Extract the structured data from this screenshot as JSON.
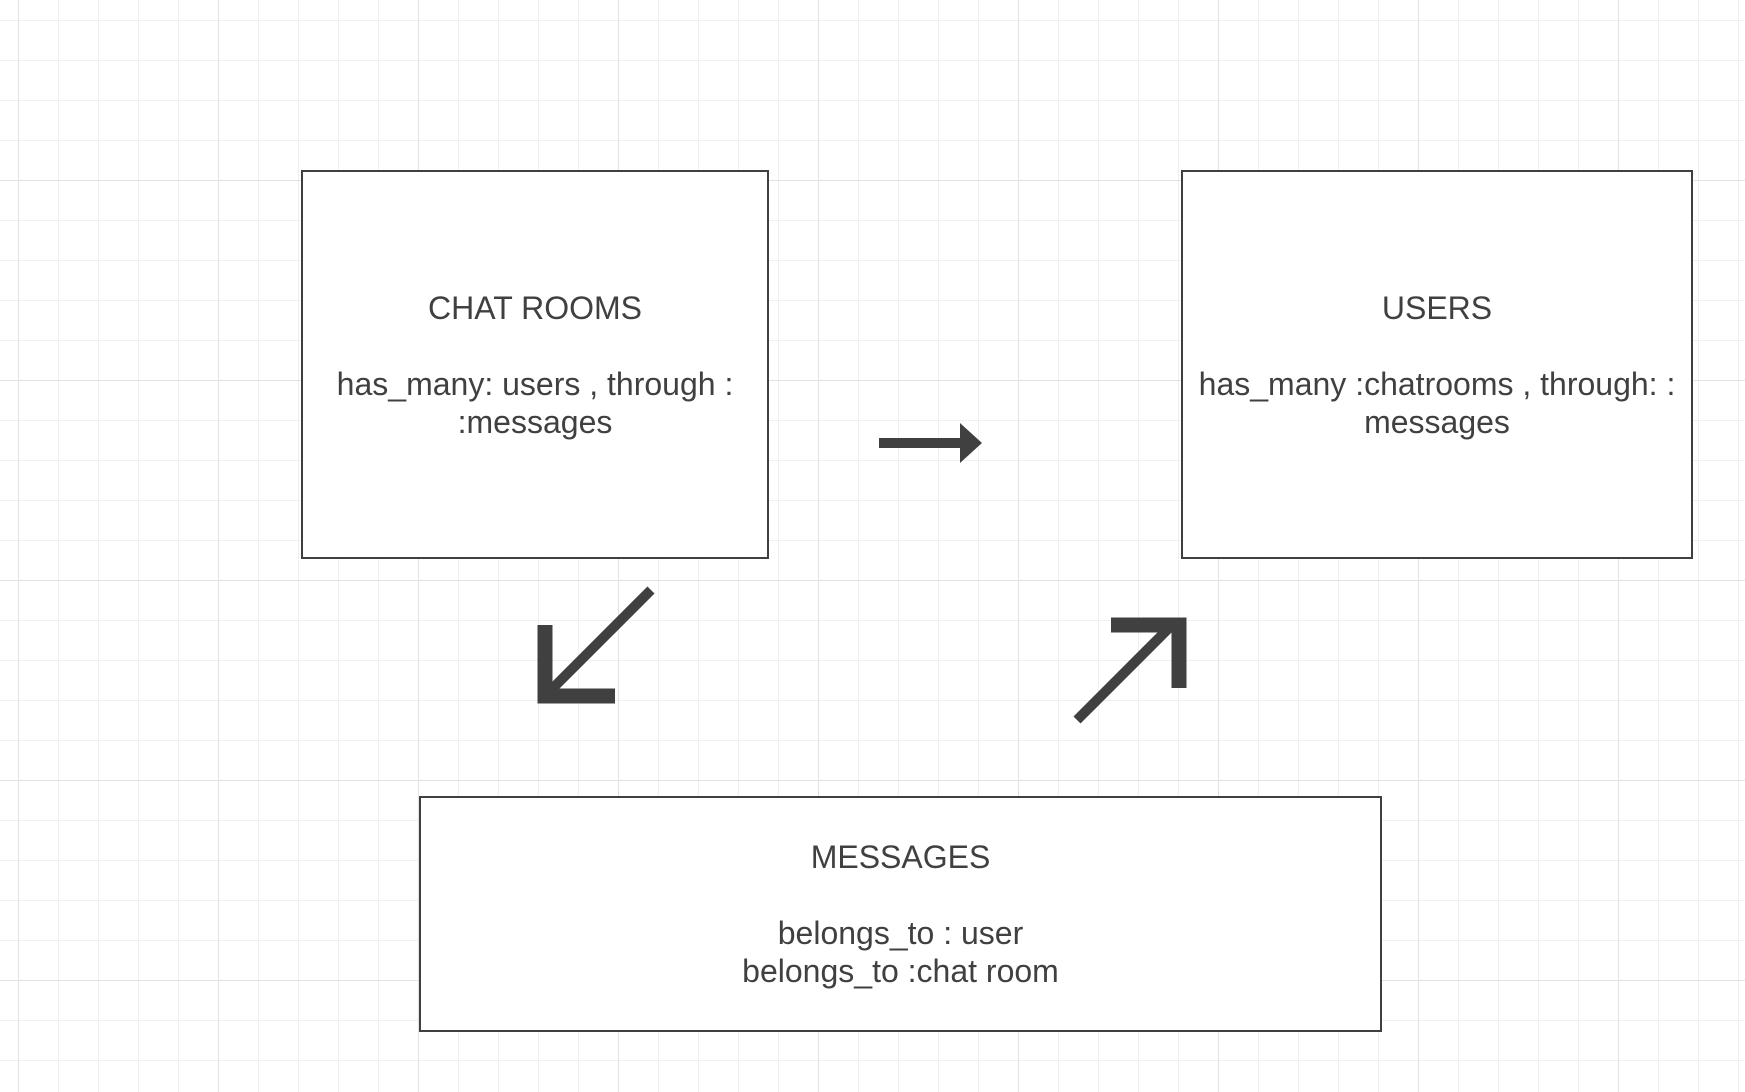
{
  "entities": {
    "chat_rooms": {
      "title": "CHAT ROOMS",
      "lines": [
        "has_many: users , through :",
        ":messages"
      ]
    },
    "users": {
      "title": "USERS",
      "lines": [
        "has_many :chatrooms , through: :",
        "messages"
      ]
    },
    "messages": {
      "title": "MESSAGES",
      "lines": [
        "belongs_to : user",
        "belongs_to :chat room"
      ]
    }
  },
  "arrows": [
    {
      "name": "chat-rooms-to-users-arrow",
      "direction": "right"
    },
    {
      "name": "chat-rooms-to-messages-arrow",
      "direction": "down-left"
    },
    {
      "name": "messages-to-users-arrow",
      "direction": "up-right"
    }
  ],
  "colors": {
    "stroke": "#404040",
    "text": "#404040",
    "background": "#ffffff",
    "grid": "#e2e2e2"
  }
}
